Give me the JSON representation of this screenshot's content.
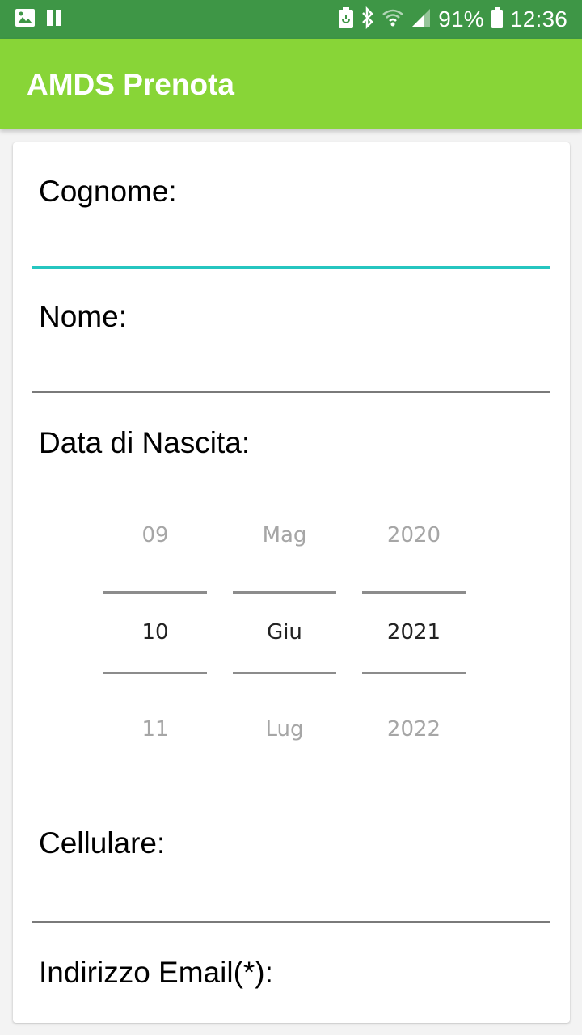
{
  "status_bar": {
    "battery": "91%",
    "time": "12:36",
    "icons_left": [
      "image-icon",
      "pause-icon"
    ],
    "icons_right": [
      "battery-saver-icon",
      "bluetooth-icon",
      "wifi-icon",
      "signal-icon",
      "battery-icon"
    ]
  },
  "app_bar": {
    "title": "AMDS Prenota",
    "color": "#88d537"
  },
  "form": {
    "cognome_label": "Cognome:",
    "nome_label": "Nome:",
    "data_nascita_label": "Data di Nascita:",
    "cellulare_label": "Cellulare:",
    "email_label": "Indirizzo Email(*):",
    "focus_color": "#26c6c0"
  },
  "date_picker": {
    "day": {
      "prev": "09",
      "selected": "10",
      "next": "11"
    },
    "month": {
      "prev": "Mag",
      "selected": "Giu",
      "next": "Lug"
    },
    "year": {
      "prev": "2020",
      "selected": "2021",
      "next": "2022"
    }
  }
}
